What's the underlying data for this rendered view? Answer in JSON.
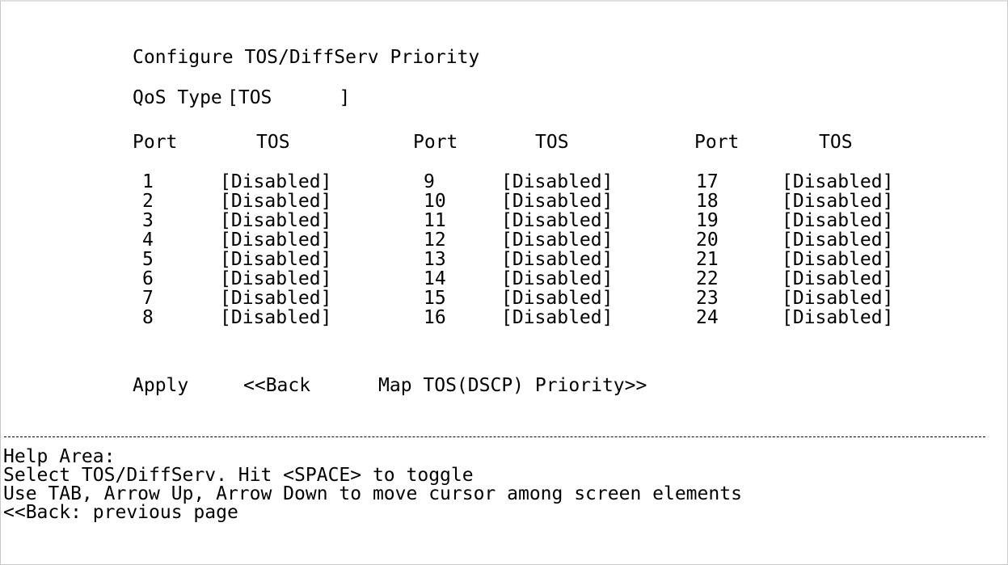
{
  "screen": {
    "title": "Configure TOS/DiffServ Priority",
    "qos_type_label": "QoS Type",
    "qos_type_value": "[TOS      ]"
  },
  "table": {
    "headers": [
      "Port",
      "TOS",
      "Port",
      "TOS",
      "Port",
      "TOS"
    ],
    "columns": [
      {
        "ports": [
          "1",
          "2",
          "3",
          "4",
          "5",
          "6",
          "7",
          "8"
        ],
        "values": [
          "[Disabled]",
          "[Disabled]",
          "[Disabled]",
          "[Disabled]",
          "[Disabled]",
          "[Disabled]",
          "[Disabled]",
          "[Disabled]"
        ]
      },
      {
        "ports": [
          "9",
          "10",
          "11",
          "12",
          "13",
          "14",
          "15",
          "16"
        ],
        "values": [
          "[Disabled]",
          "[Disabled]",
          "[Disabled]",
          "[Disabled]",
          "[Disabled]",
          "[Disabled]",
          "[Disabled]",
          "[Disabled]"
        ]
      },
      {
        "ports": [
          "17",
          "18",
          "19",
          "20",
          "21",
          "22",
          "23",
          "24"
        ],
        "values": [
          "[Disabled]",
          "[Disabled]",
          "[Disabled]",
          "[Disabled]",
          "[Disabled]",
          "[Disabled]",
          "[Disabled]",
          "[Disabled]"
        ]
      }
    ]
  },
  "actions": {
    "apply": "Apply",
    "back": "<<Back",
    "map": "Map TOS(DSCP) Priority>>"
  },
  "help": {
    "title": "Help Area:",
    "lines": [
      "Select TOS/DiffServ. Hit <SPACE> to toggle",
      "Use TAB, Arrow Up, Arrow Down to move cursor among screen elements",
      "<<Back: previous page"
    ]
  }
}
